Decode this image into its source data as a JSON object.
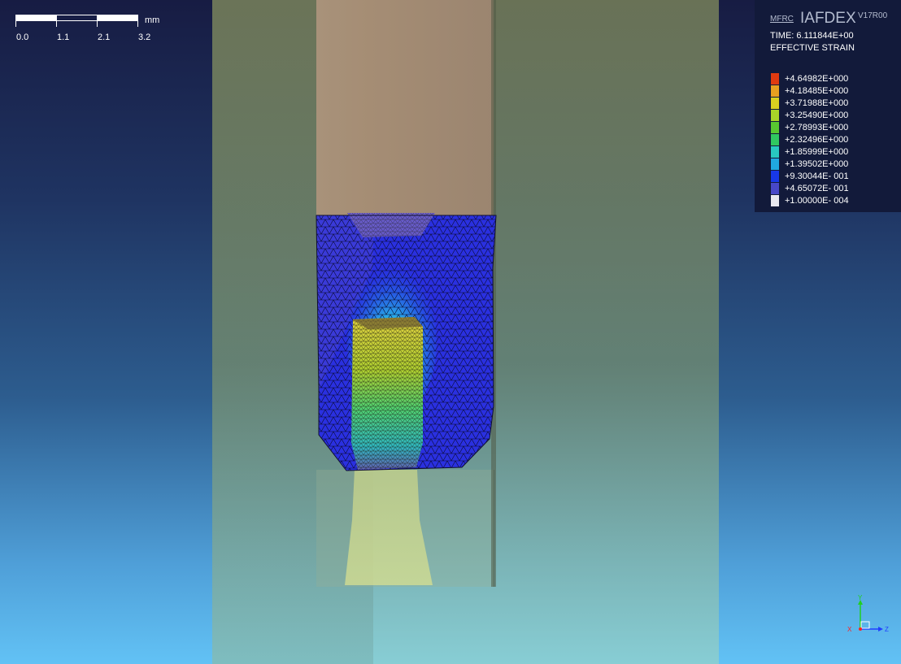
{
  "scale_bar": {
    "labels": [
      "0.0",
      "1.1",
      "2.1",
      "3.2"
    ],
    "unit": "mm"
  },
  "legend": {
    "brand_prefix": "MFRC",
    "brand_name": "IAFDEX",
    "version": "V17R00",
    "time": "TIME: 6.111844E+00",
    "variable": "EFFECTIVE STRAIN",
    "entries": [
      {
        "label": "+4.64982E+000",
        "color": "#e03a10"
      },
      {
        "label": "+4.18485E+000",
        "color": "#e8a020"
      },
      {
        "label": "+3.71988E+000",
        "color": "#d8d020"
      },
      {
        "label": "+3.25490E+000",
        "color": "#a8d428"
      },
      {
        "label": "+2.78993E+000",
        "color": "#58c830"
      },
      {
        "label": "+2.32496E+000",
        "color": "#30c860"
      },
      {
        "label": "+1.85999E+000",
        "color": "#28c8c0"
      },
      {
        "label": "+1.39502E+000",
        "color": "#20a8e0"
      },
      {
        "label": "+9.30044E- 001",
        "color": "#1838e8"
      },
      {
        "label": "+4.65072E- 001",
        "color": "#4848c8"
      },
      {
        "label": "+1.00000E- 004",
        "color": "#e8e8f0"
      }
    ]
  },
  "triad": {
    "axes": [
      "X",
      "Y",
      "Z"
    ],
    "colors": {
      "x": "#ff2020",
      "y": "#20d020",
      "z": "#2040ff"
    }
  }
}
